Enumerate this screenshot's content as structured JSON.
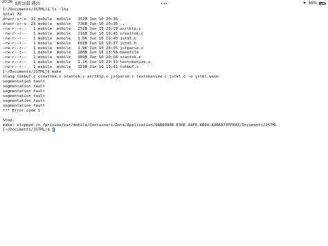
{
  "status_bar": {
    "time": "20:36",
    "date": "6月10日 週六",
    "battery_percent": "66%",
    "battery_level": 0.66,
    "wifi_icon": "wifi-icon",
    "battery_icon": "battery-icon"
  },
  "terminal": {
    "lines": [
      "[~/Documents/JSTML]$ ls -lha",
      "total 72",
      "drwxr-xr-x  11 mobile  mobile   352B Jun 10 20:36 .",
      "drwxr-xr-x  23 mobile  mobile   736B Jun 10 20:36 ..",
      "-rw-r--r--   1 mobile  mobile   252B Jun 10 20:10 asrtktp.c",
      "-rw-r--r--   1 mobile  mobile   216B Jun 10 19:45 creattok.c",
      "-rw-r--r--   1 mobile  mobile   1.0K Jun 10 19:40 jstml.c",
      "-rw-r--r--   1 mobile  mobile   602B Jun 10 19:37 jstml.h",
      "-rw-r--r--   1 mobile  mobile   1.9K Jun 10 20:35 jstparse.c",
      "-rw-r--r--   1 mobile  mobile   208B Jun 10 13:58 makefile",
      "-rw-r--r--   1 mobile  mobile   969B Jun 10 20:28 scantok.c",
      "-rw-r--r--   1 mobile  mobile   1.1K Jun 10 20:33 textokenize.c",
      "-rw-r--r--   1 mobile  mobile   323B Jun 10 19:41 tokbuf.c",
      "[~/Documents/JSTML]$ make",
      "clang tokbuf.c creattok.c scantok.c asrtktp.c jstparse.c textokenize.c jstml.c -o jstml.wasm",
      "segmentation fault",
      "segmentation fault",
      "segmentation fault",
      "segmentation fault",
      "segmentation fault",
      "segmentation fault",
      "*** Error code 1",
      "",
      "Stop.",
      "make: stopped in /private/var/mobile/Containers/Data/Application/0AB8996E-E36E-44FE-AB04-A3B6A73FFEA3/Documents/JSTML"
    ],
    "prompt": "[~/Documents/JSTML]$ "
  }
}
